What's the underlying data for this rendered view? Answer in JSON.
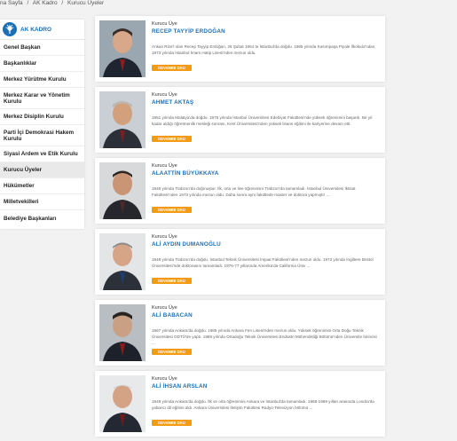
{
  "breadcrumb": {
    "home": "na Sayfa",
    "sep1": "/",
    "section": "AK Kadro",
    "sep2": "/",
    "current": "Kurucu Üyeler"
  },
  "sidebar": {
    "title": "AK KADRO",
    "items": [
      {
        "label": "Genel Başkan"
      },
      {
        "label": "Başkanlıklar"
      },
      {
        "label": "Merkez Yürütme Kurulu"
      },
      {
        "label": "Merkez Karar ve Yönetim Kurulu"
      },
      {
        "label": "Merkez Disiplin Kurulu"
      },
      {
        "label": "Parti İçi Demokrasi Hakem Kurulu"
      },
      {
        "label": "Siyasi Ardem ve Etik Kurulu"
      },
      {
        "label": "Kurucu Üyeler"
      },
      {
        "label": "Hükümetler"
      },
      {
        "label": "Milletvekilleri"
      },
      {
        "label": "Belediye Başkanları"
      }
    ]
  },
  "members": [
    {
      "role": "Kurucu Üye",
      "name": "RECEP TAYYİP ERDOĞAN",
      "desc": "Ankan Rize'l olan Recep Tayyip Erdoğan, 26 Şubat 1954 te İstanbul'da doğdu. 1965 yılında Kasımpaşa Piyale İlkokulu'ndan, 1973 yılında İstanbul İmam Hatip Lisesi'nden mezun oldu.",
      "button": "DEVAMINI OKU"
    },
    {
      "role": "Kurucu Üye",
      "name": "AHMET AKTAŞ",
      "desc": "1951 yılında Malatya'da doğdu. 1975 yılında İstanbul Üniversitesi Edebiyat Fakültesi'nde yüksek öğrenimini başardı. Bir yıl kadar aldığı öğretmenlik mesleği sonrası, Kent Üniversitesi'nden yüksek lisans eğitimi ile kariyerine devam etti.",
      "button": "DEVAMINI OKU"
    },
    {
      "role": "Kurucu Üye",
      "name": "ALAATTİN BÜYÜKKAYA",
      "desc": "1946 yılında Trabzon'da doğmuştur. İlk, orta ve lise öğrenimini Trabzon'da tamamladı. İstanbul Üniversitesi İktisat Fakültesi'nden 1973 yılında mezun oldu. Daha sonra aynı fakültede master ve doktora yapmıştır ...",
      "button": "DEVAMINI OKU"
    },
    {
      "role": "Kurucu Üye",
      "name": "ALİ AYDIN DUMANOĞLU",
      "desc": "1948 yılında Trabzon'da doğdu. İstanbul Teknik Üniversitesi İnşaat Fakültesi'nden mezun oldu. 1972 yılında İngiltere Bristol Üniversitesi'nde doktorasını tamamladı. 1976-77 yıllarında Amerika'da California Üniv ...",
      "button": "DEVAMINI OKU"
    },
    {
      "role": "Kurucu Üye",
      "name": "ALİ BABACAN",
      "desc": "1967 yılında Ankara'da doğdu. 1985 yılında Ankara Fen Lisesi'nden mezun oldu. Yüksek öğrenimini Orta Doğu Teknik Üniversitesi ODTÜ'de yaptı. 1989 yılında Ortadoğu Teknik Üniversitesi Endüstri Mühendisliği Bölümü'nden Üniversite birincisi ...",
      "button": "DEVAMINI OKU"
    },
    {
      "role": "Kurucu Üye",
      "name": "ALİ İHSAN ARSLAN",
      "desc": "1949 yılında Ankara'da doğdu. İlk ve orta öğrenimini Ankara ve İstanbul'da tamamladı. 1968-1969 yılları arasında Londra'da yabancı dil eğitimi aldı. Ankara Üniversitesi İletişim Fakültesi Radyo-Televizyon bölümü ...",
      "button": "DEVAMINI OKU"
    }
  ]
}
